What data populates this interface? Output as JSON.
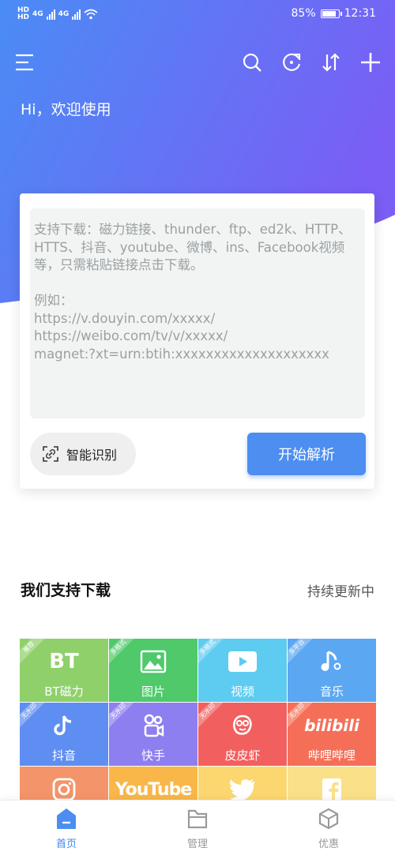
{
  "status_bar": {
    "network_1": "4G",
    "network_2": "4G",
    "battery_percent": "85%",
    "time": "12:31"
  },
  "header": {
    "greeting": "Hi，欢迎使用"
  },
  "toolbar": {
    "icons": [
      "menu-icon",
      "search-icon",
      "refresh-icon",
      "sort-icon",
      "add-icon"
    ]
  },
  "input": {
    "placeholder": "支持下载：磁力链接、thunder、ftp、ed2k、HTTP、HTTS、抖音、youtube、微博、ins、Facebook视频等，只需粘贴链接点击下载。\n\n例如：\nhttps://v.douyin.com/xxxxx/\nhttps://weibo.com/tv/v/xxxxx/\nmagnet:?xt=urn:btih:xxxxxxxxxxxxxxxxxxxx"
  },
  "actions": {
    "smart_recognize": "智能识别",
    "start_parse": "开始解析"
  },
  "section": {
    "title": "我们支持下载",
    "subtitle": "持续更新中"
  },
  "tiles": [
    {
      "label": "BT磁力",
      "badge": "推荐",
      "icon_text": "BT",
      "icon": "bt-icon",
      "color": "#8fd06a"
    },
    {
      "label": "图片",
      "badge": "多格式",
      "icon": "image-icon",
      "color": "#4fc96a"
    },
    {
      "label": "视频",
      "badge": "多格式",
      "icon": "video-icon",
      "color": "#5ecbf0"
    },
    {
      "label": "音乐",
      "badge": "多平台",
      "icon": "music-icon",
      "color": "#5ba7f2"
    },
    {
      "label": "抖音",
      "badge": "无水印",
      "icon": "douyin-icon",
      "color": "#5e8ef2"
    },
    {
      "label": "快手",
      "badge": "无水印",
      "icon": "kuaishou-icon",
      "color": "#8d7ff0"
    },
    {
      "label": "皮皮虾",
      "badge": "无水印",
      "icon": "pipixia-icon",
      "color": "#f25f5f"
    },
    {
      "label": "哔哩哔哩",
      "badge": "无水印",
      "icon_text": "bilibili",
      "icon": "bilibili-icon",
      "color": "#f56f58"
    },
    {
      "label": "",
      "badge": "",
      "icon": "instagram-icon",
      "color": "#f4946a"
    },
    {
      "label": "",
      "badge": "",
      "icon_text": "YouTube",
      "icon": "youtube-icon",
      "color": "#f9b74a"
    },
    {
      "label": "",
      "badge": "",
      "icon": "twitter-icon",
      "color": "#fcd770"
    },
    {
      "label": "",
      "badge": "",
      "icon": "facebook-icon",
      "color": "#fbe08a"
    }
  ],
  "bottom_nav": [
    {
      "label": "首页",
      "icon": "home-icon",
      "active": true
    },
    {
      "label": "管理",
      "icon": "folder-icon",
      "active": false
    },
    {
      "label": "优惠",
      "icon": "box-icon",
      "active": false
    }
  ],
  "colors": {
    "hero_start": "#4a8cf5",
    "hero_end": "#7a5ef5",
    "accent": "#4d8ef0"
  }
}
